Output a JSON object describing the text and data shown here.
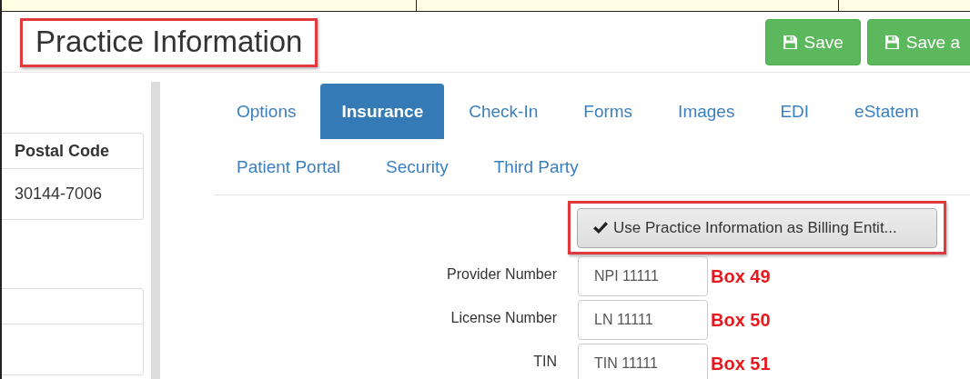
{
  "page": {
    "title": "Practice Information",
    "title_highlighted": true
  },
  "toolbar": {
    "buttons": [
      {
        "label": "Save"
      },
      {
        "label": "Save a"
      }
    ]
  },
  "side_table": {
    "columns": [
      "Postal Code"
    ],
    "rows": [
      [
        "30144-7006"
      ]
    ]
  },
  "tab_rows": [
    [
      {
        "label": "Options",
        "selected": false
      },
      {
        "label": "Insurance",
        "selected": true
      },
      {
        "label": "Check-In",
        "selected": false
      },
      {
        "label": "Forms",
        "selected": false
      },
      {
        "label": "Images",
        "selected": false
      },
      {
        "label": "EDI",
        "selected": false
      },
      {
        "label": "eStatem",
        "selected": false
      }
    ],
    [
      {
        "label": "Patient Portal",
        "selected": false
      },
      {
        "label": "Security",
        "selected": false
      },
      {
        "label": "Third Party",
        "selected": false
      }
    ]
  ],
  "billing_button": {
    "label": "Use Practice Information as Billing Entit...",
    "highlighted": true
  },
  "fields": [
    {
      "label": "Provider Number",
      "value": "NPI 11111",
      "note": "Box 49"
    },
    {
      "label": "License Number",
      "value": "LN 11111",
      "note": "Box 50"
    },
    {
      "label": "TIN",
      "value": "TIN 11111",
      "note": "Box 51"
    }
  ]
}
